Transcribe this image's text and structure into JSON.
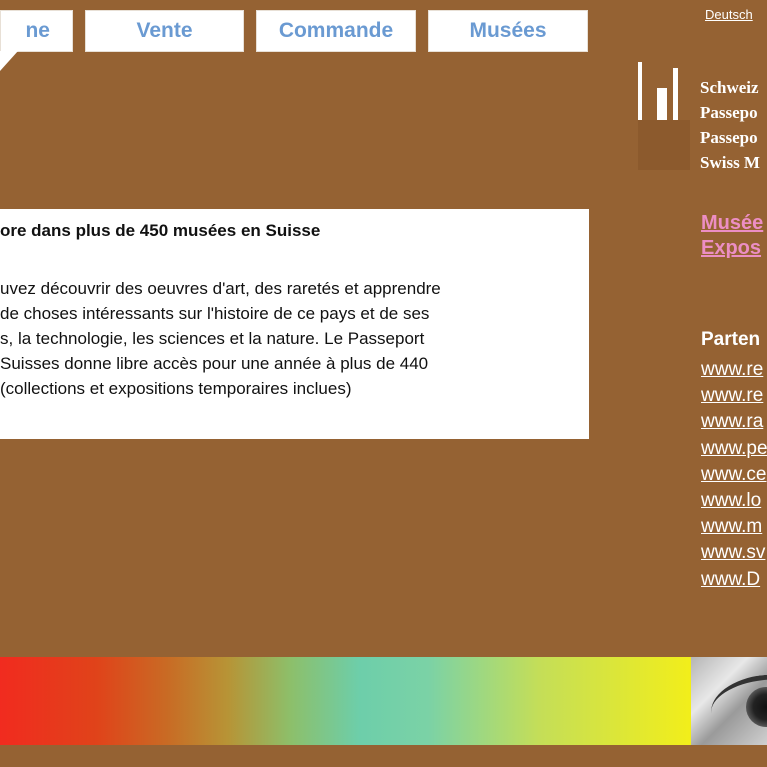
{
  "nav": {
    "tabs": [
      {
        "label": "ne"
      },
      {
        "label": "Vente"
      },
      {
        "label": "Commande"
      },
      {
        "label": "Musées"
      }
    ],
    "lang_link": "Deutsch"
  },
  "logo": {
    "lines": [
      "Schweiz",
      "Passepo",
      "Passepo",
      "Swiss M"
    ]
  },
  "side_links": [
    "Musée",
    "Expos"
  ],
  "partners": {
    "title": "Parten",
    "links": [
      "www.re",
      "www.re",
      "www.ra",
      "www.pe",
      "www.ce",
      "www.lo",
      "www.m",
      "www.sv",
      "www.D"
    ]
  },
  "content": {
    "title": "ore dans plus de 450 musées en Suisse",
    "lines": [
      "uvez découvrir des oeuvres d'art, des raretés et apprendre",
      "de choses intéressants sur l'histoire de ce pays et de ses",
      "s, la technologie, les sciences et la nature. Le Passeport",
      "Suisses donne libre accès pour une année à plus de 440",
      "(collections et expositions temporaires inclues)"
    ]
  },
  "colors": {
    "background": "#956233",
    "tab_text": "#6a9ad2",
    "link_pink": "#ec8ec4"
  }
}
